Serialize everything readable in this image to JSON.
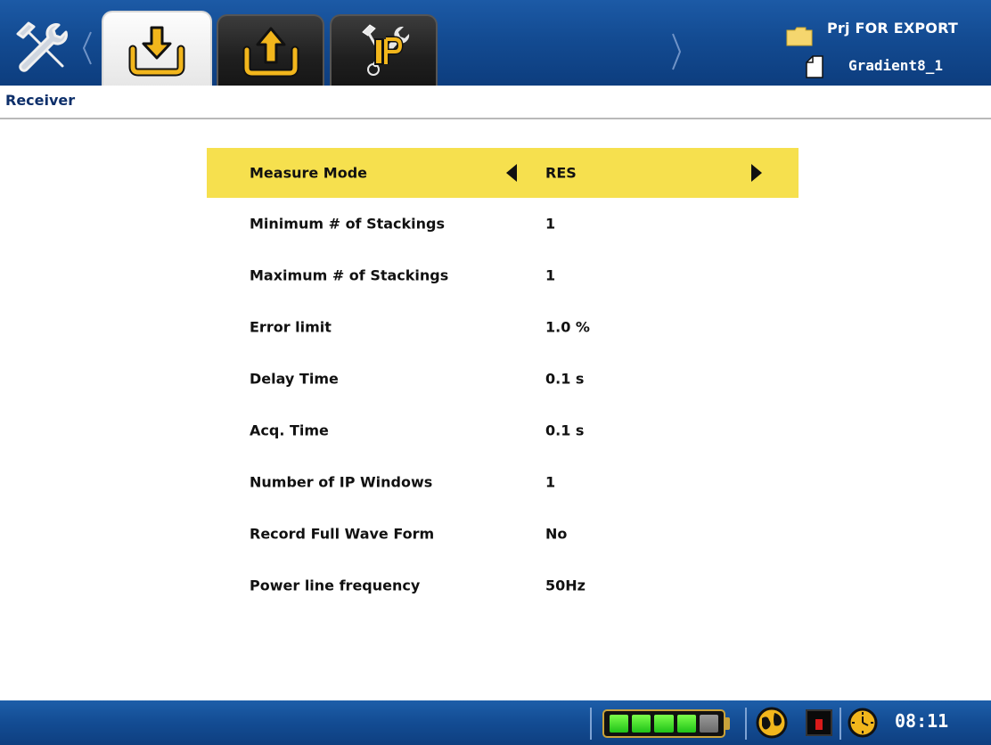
{
  "header": {
    "project_name": "Prj FOR EXPORT",
    "file_name": "Gradient8_1",
    "tabs": [
      {
        "name": "tools",
        "icon": "tools-icon"
      },
      {
        "name": "receive",
        "icon": "download-tray-icon",
        "active": true
      },
      {
        "name": "send",
        "icon": "upload-tray-icon"
      },
      {
        "name": "ip",
        "icon": "ip-tools-icon"
      }
    ]
  },
  "section": {
    "title": "Receiver"
  },
  "settings": [
    {
      "label": "Measure Mode",
      "value": "RES",
      "selected": true
    },
    {
      "label": "Minimum # of Stackings",
      "value": "1"
    },
    {
      "label": "Maximum # of Stackings",
      "value": "1"
    },
    {
      "label": "Error limit",
      "value": "1.0 %"
    },
    {
      "label": "Delay Time",
      "value": "0.1 s"
    },
    {
      "label": "Acq. Time",
      "value": "0.1 s"
    },
    {
      "label": "Number of IP Windows",
      "value": "1"
    },
    {
      "label": "Record Full Wave Form",
      "value": "No"
    },
    {
      "label": "Power line frequency",
      "value": "50Hz"
    }
  ],
  "status": {
    "battery_level": 0.8,
    "battery_cells_on": 4,
    "battery_cells_total": 5,
    "time": "08:11"
  },
  "colors": {
    "accent_bar": "#134b92",
    "selection": "#f6e04e",
    "section_title": "#0d2f6a"
  }
}
